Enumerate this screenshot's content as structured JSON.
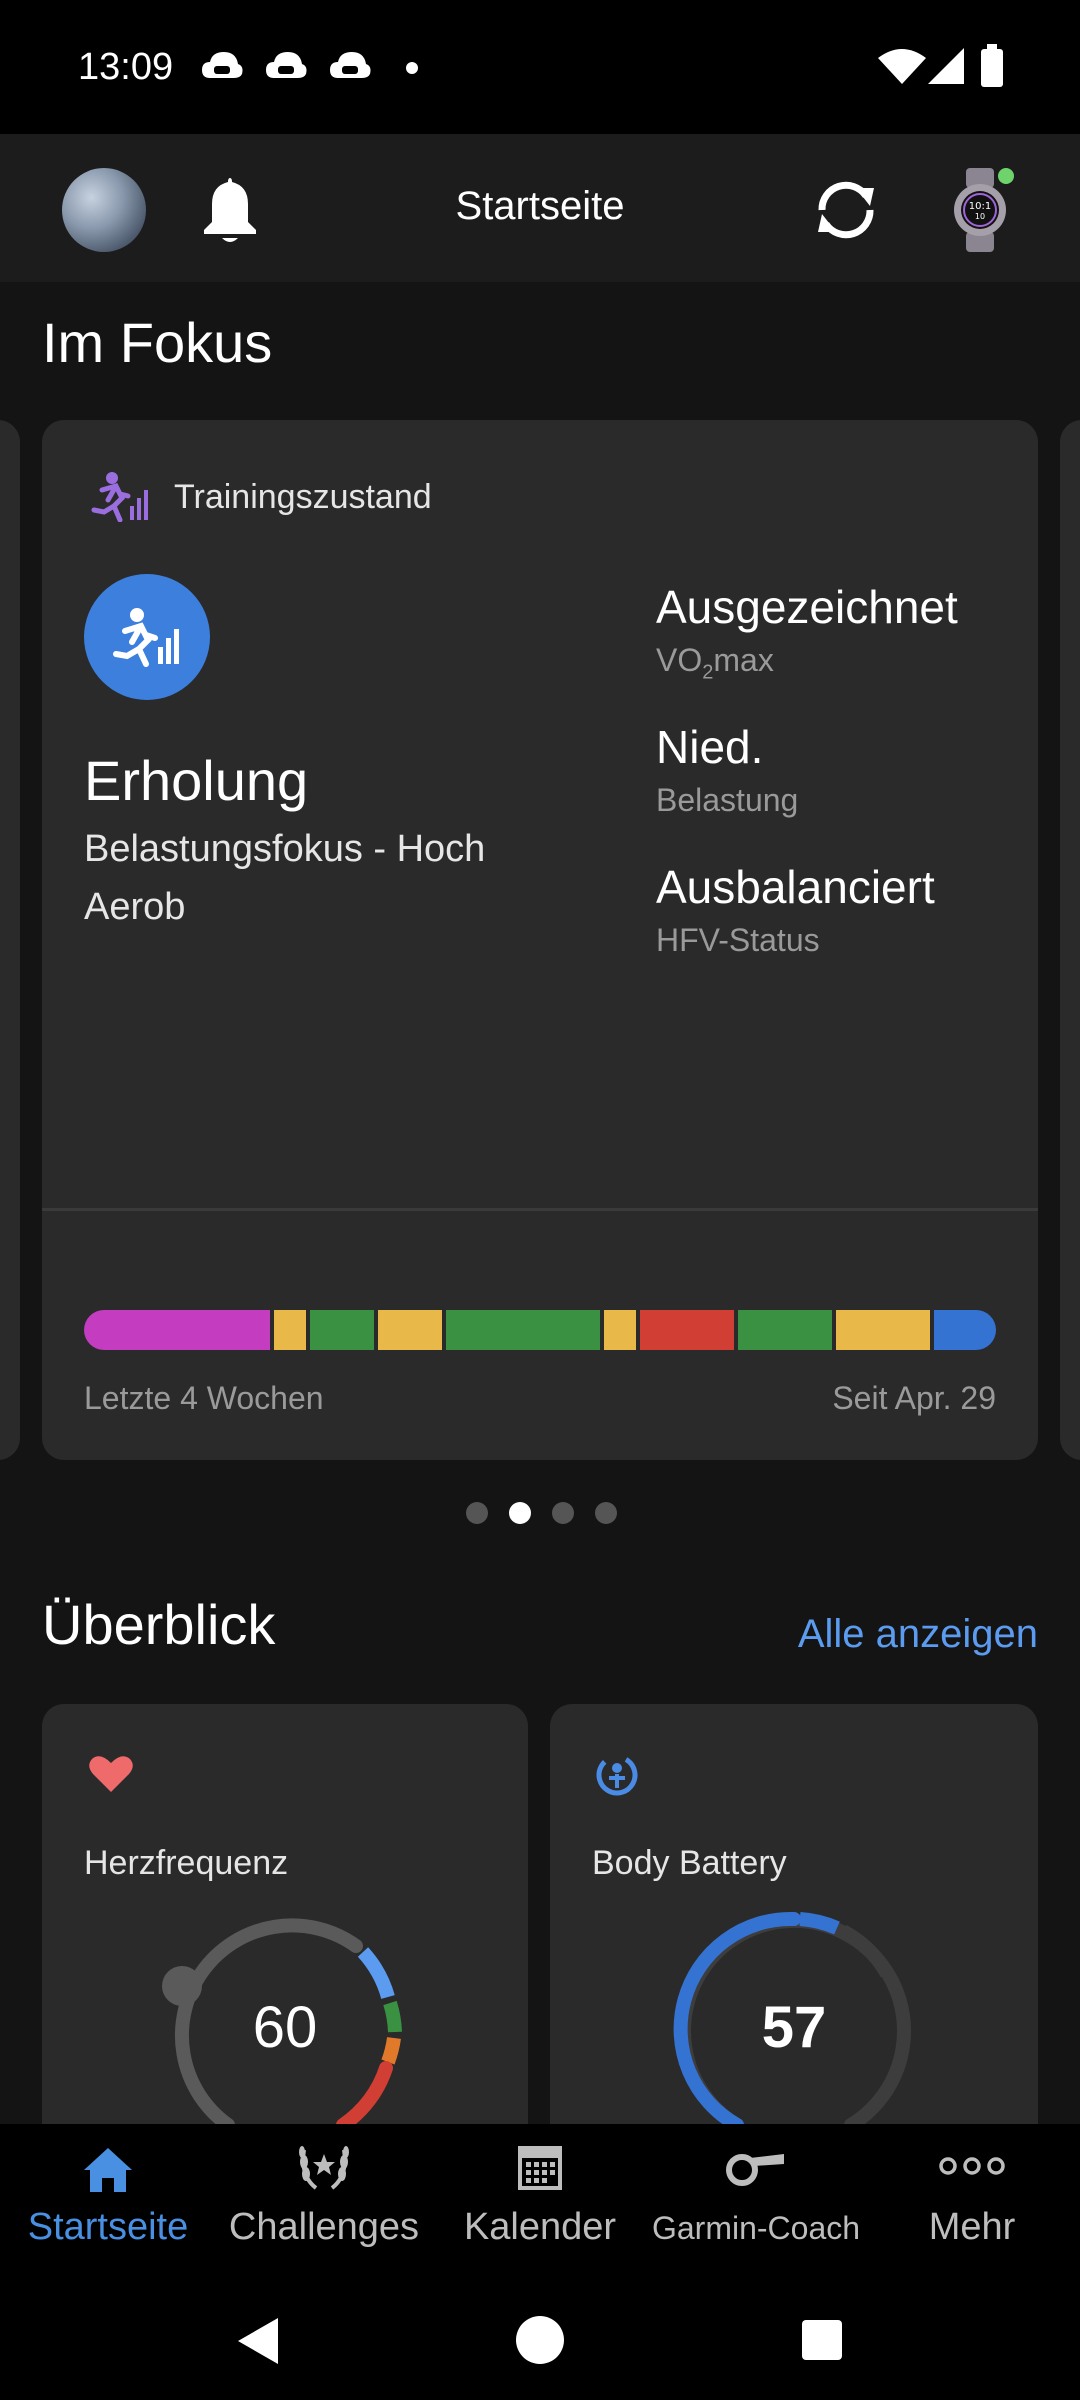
{
  "status_bar": {
    "time": "13:09",
    "icons": [
      "cloud-game-icon",
      "cloud-game-icon",
      "cloud-game-icon",
      "dot-icon",
      "wifi-icon",
      "signal-icon",
      "battery-icon"
    ]
  },
  "app_bar": {
    "title": "Startseite",
    "icons": [
      "avatar",
      "bell-icon",
      "sync-icon",
      "watch-icon"
    ]
  },
  "focus": {
    "heading": "Im Fokus",
    "card": {
      "label": "Trainingszustand",
      "status": "Erholung",
      "subtitle": "Belastungsfokus - Hoch Aerob",
      "metrics": [
        {
          "value": "Ausgezeichnet",
          "label_main": "VO",
          "label_sub": "2",
          "label_rest": "max"
        },
        {
          "value": "Nied.",
          "label_main": "Belastung",
          "label_sub": "",
          "label_rest": ""
        },
        {
          "value": "Ausbalanciert",
          "label_main": "HFV-Status",
          "label_sub": "",
          "label_rest": ""
        }
      ],
      "timeline_left": "Letzte 4 Wochen",
      "timeline_right": "Seit Apr. 29",
      "timeline_colors": [
        "#c43cbf",
        "#e8b949",
        "#3a9142",
        "#e8b949",
        "#3a9142",
        "#e8b949",
        "#d13e33",
        "#3a9142",
        "#e8b949",
        "#3573d3"
      ]
    },
    "pager": {
      "count": 4,
      "active": 2
    }
  },
  "overview": {
    "heading": "Überblick",
    "show_all": "Alle anzeigen",
    "cards": [
      {
        "title": "Herzfrequenz",
        "value": "60",
        "icon": "heart-icon"
      },
      {
        "title": "Body Battery",
        "value": "57",
        "icon": "body-battery-icon"
      }
    ]
  },
  "bottom_nav": [
    {
      "label": "Startseite",
      "icon": "home-icon",
      "active": true
    },
    {
      "label": "Challenges",
      "icon": "laurel-icon",
      "active": false
    },
    {
      "label": "Kalender",
      "icon": "calendar-icon",
      "active": false
    },
    {
      "label": "Garmin-Coach",
      "icon": "whistle-icon",
      "active": false
    },
    {
      "label": "Mehr",
      "icon": "more-icon",
      "active": false
    }
  ],
  "system_nav": [
    "back-icon",
    "home-circle-icon",
    "recents-icon"
  ],
  "colors": {
    "accent": "#3c7fdc",
    "link": "#5b9bf0",
    "active_nav": "#4a90e2",
    "card_bg": "#2a2a2a"
  }
}
